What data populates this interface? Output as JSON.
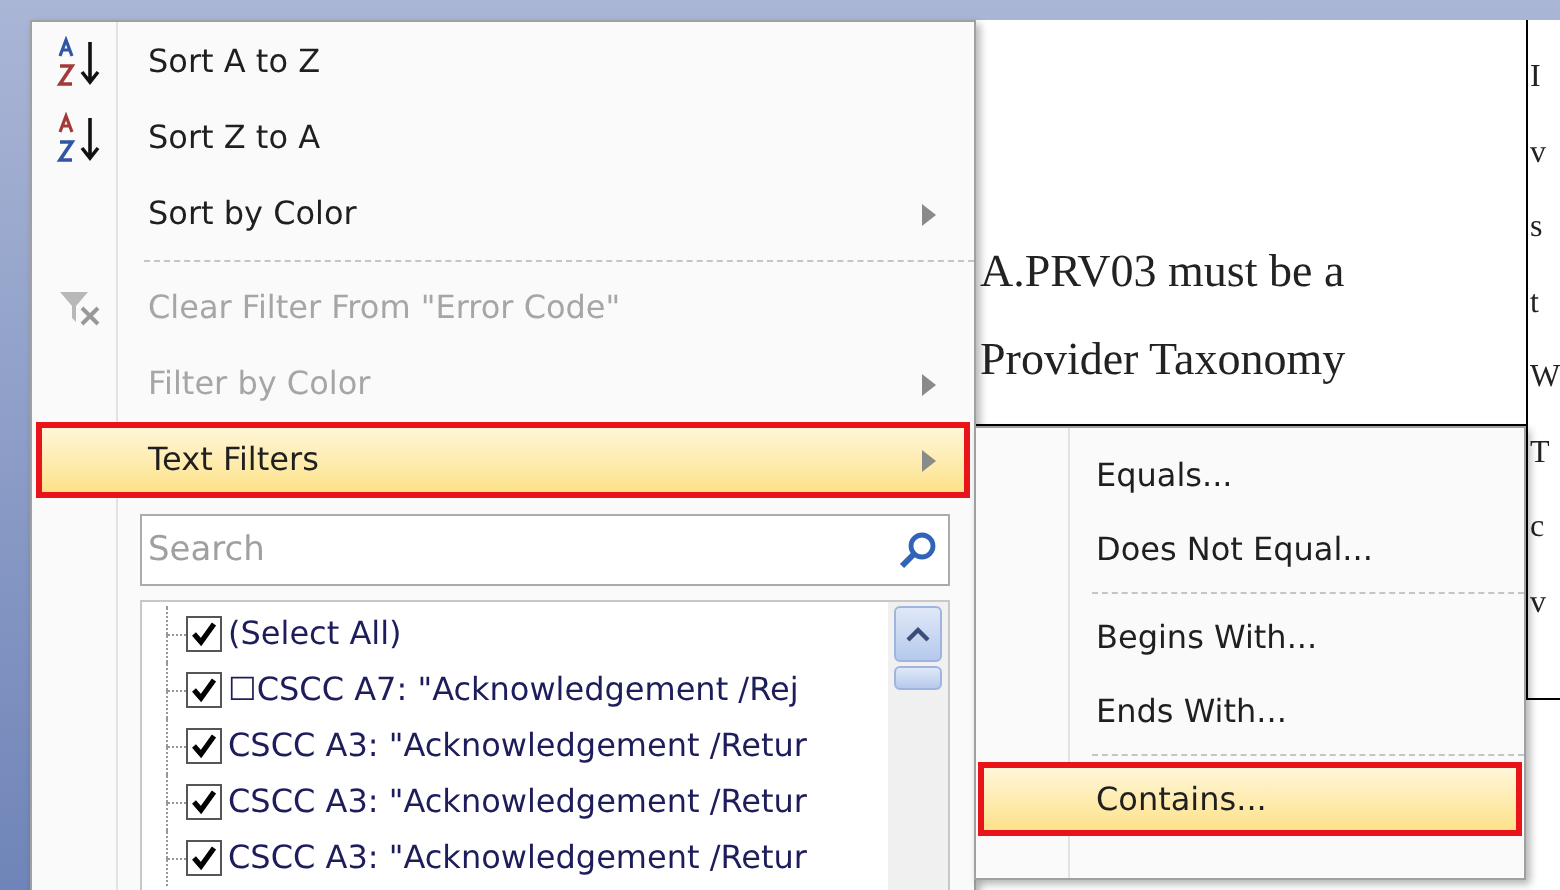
{
  "menu": {
    "items": [
      {
        "kind": "sort-ascending",
        "label": "Sort A to Z",
        "disabled": false,
        "submenu": false,
        "selected": false
      },
      {
        "kind": "sort-descending",
        "label": "Sort Z to A",
        "disabled": false,
        "submenu": false,
        "selected": false
      },
      {
        "kind": "plain",
        "label": "Sort by Color",
        "disabled": false,
        "submenu": true,
        "selected": false
      },
      {
        "kind": "separator"
      },
      {
        "kind": "clear-filter",
        "label": "Clear Filter From \"Error Code\"",
        "disabled": true,
        "submenu": false,
        "selected": false
      },
      {
        "kind": "plain",
        "label": "Filter by Color",
        "disabled": true,
        "submenu": true,
        "selected": false
      },
      {
        "kind": "plain",
        "label": "Text Filters",
        "disabled": false,
        "submenu": true,
        "selected": true
      }
    ],
    "search": {
      "placeholder": "Search"
    },
    "values": [
      {
        "label": "(Select All)",
        "checked": true
      },
      {
        "label": "☐CSCC A7: \"Acknowledgement /Rej",
        "checked": true
      },
      {
        "label": "CSCC A3: \"Acknowledgement /Retur",
        "checked": true
      },
      {
        "label": "CSCC A3: \"Acknowledgement /Retur",
        "checked": true
      },
      {
        "label": "CSCC A3: \"Acknowledgement /Retur",
        "checked": true
      }
    ]
  },
  "submenu": {
    "items": [
      {
        "kind": "item",
        "label": "Equals...",
        "selected": false
      },
      {
        "kind": "item",
        "label": "Does Not Equal...",
        "selected": false
      },
      {
        "kind": "separator"
      },
      {
        "kind": "item",
        "label": "Begins With...",
        "selected": false
      },
      {
        "kind": "item",
        "label": "Ends With...",
        "selected": false
      },
      {
        "kind": "separator"
      },
      {
        "kind": "item",
        "label": "Contains...",
        "selected": true
      }
    ]
  },
  "document": {
    "cell_lines": [
      "A.PRV03 must be a",
      "Provider Taxonomy"
    ],
    "column_letters": [
      "I",
      "v",
      "s",
      "t",
      "W",
      "T",
      "c",
      "v"
    ]
  }
}
